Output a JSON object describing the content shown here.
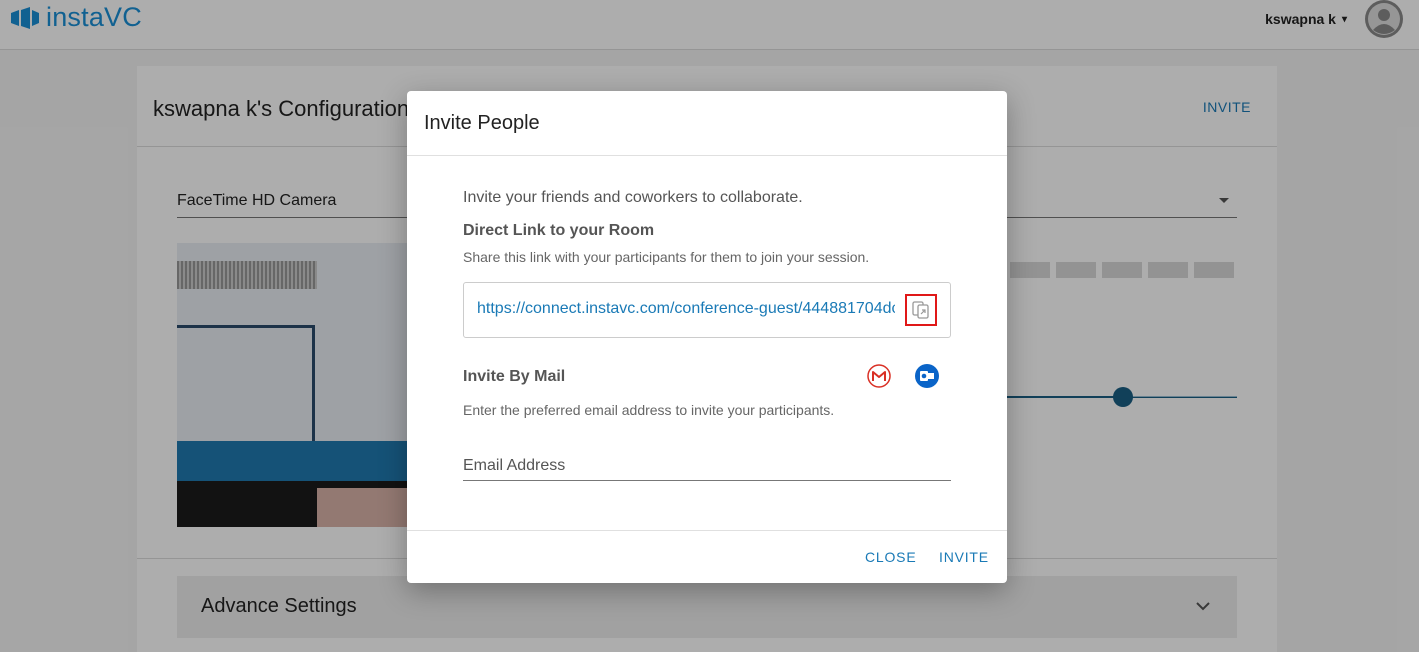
{
  "app": {
    "name": "instaVC"
  },
  "header": {
    "user_name": "kswapna k",
    "caret": "▾"
  },
  "page": {
    "title": "kswapna k's Configuration",
    "invite_label": "INVITE",
    "camera_select_value": "FaceTime HD Camera",
    "advance_settings_label": "Advance Settings",
    "mic_level_bars": 5,
    "volume_slider_fraction": 0.46
  },
  "dialog": {
    "title": "Invite People",
    "intro": "Invite your friends and coworkers to collaborate.",
    "direct_link_title": "Direct Link to your Room",
    "direct_link_desc": "Share this link with your participants for them to join your session.",
    "direct_link_url": "https://connect.instavc.com/conference-guest/444881704dc",
    "invite_by_mail_title": "Invite By Mail",
    "invite_by_mail_desc": "Enter the preferred email address to invite your participants.",
    "email_placeholder": "Email Address",
    "close_label": "CLOSE",
    "invite_label": "INVITE"
  },
  "colors": {
    "accent": "#1a7ab6",
    "logo": "#1a8fd6",
    "slider": "#1a5f84",
    "highlight_box": "#e01818",
    "gmail": "#d93025",
    "outlook": "#0a64c8"
  },
  "icons": [
    "instavc-logo-icon",
    "chevron-down-icon",
    "avatar-icon",
    "copy-icon",
    "gmail-icon",
    "outlook-icon"
  ]
}
